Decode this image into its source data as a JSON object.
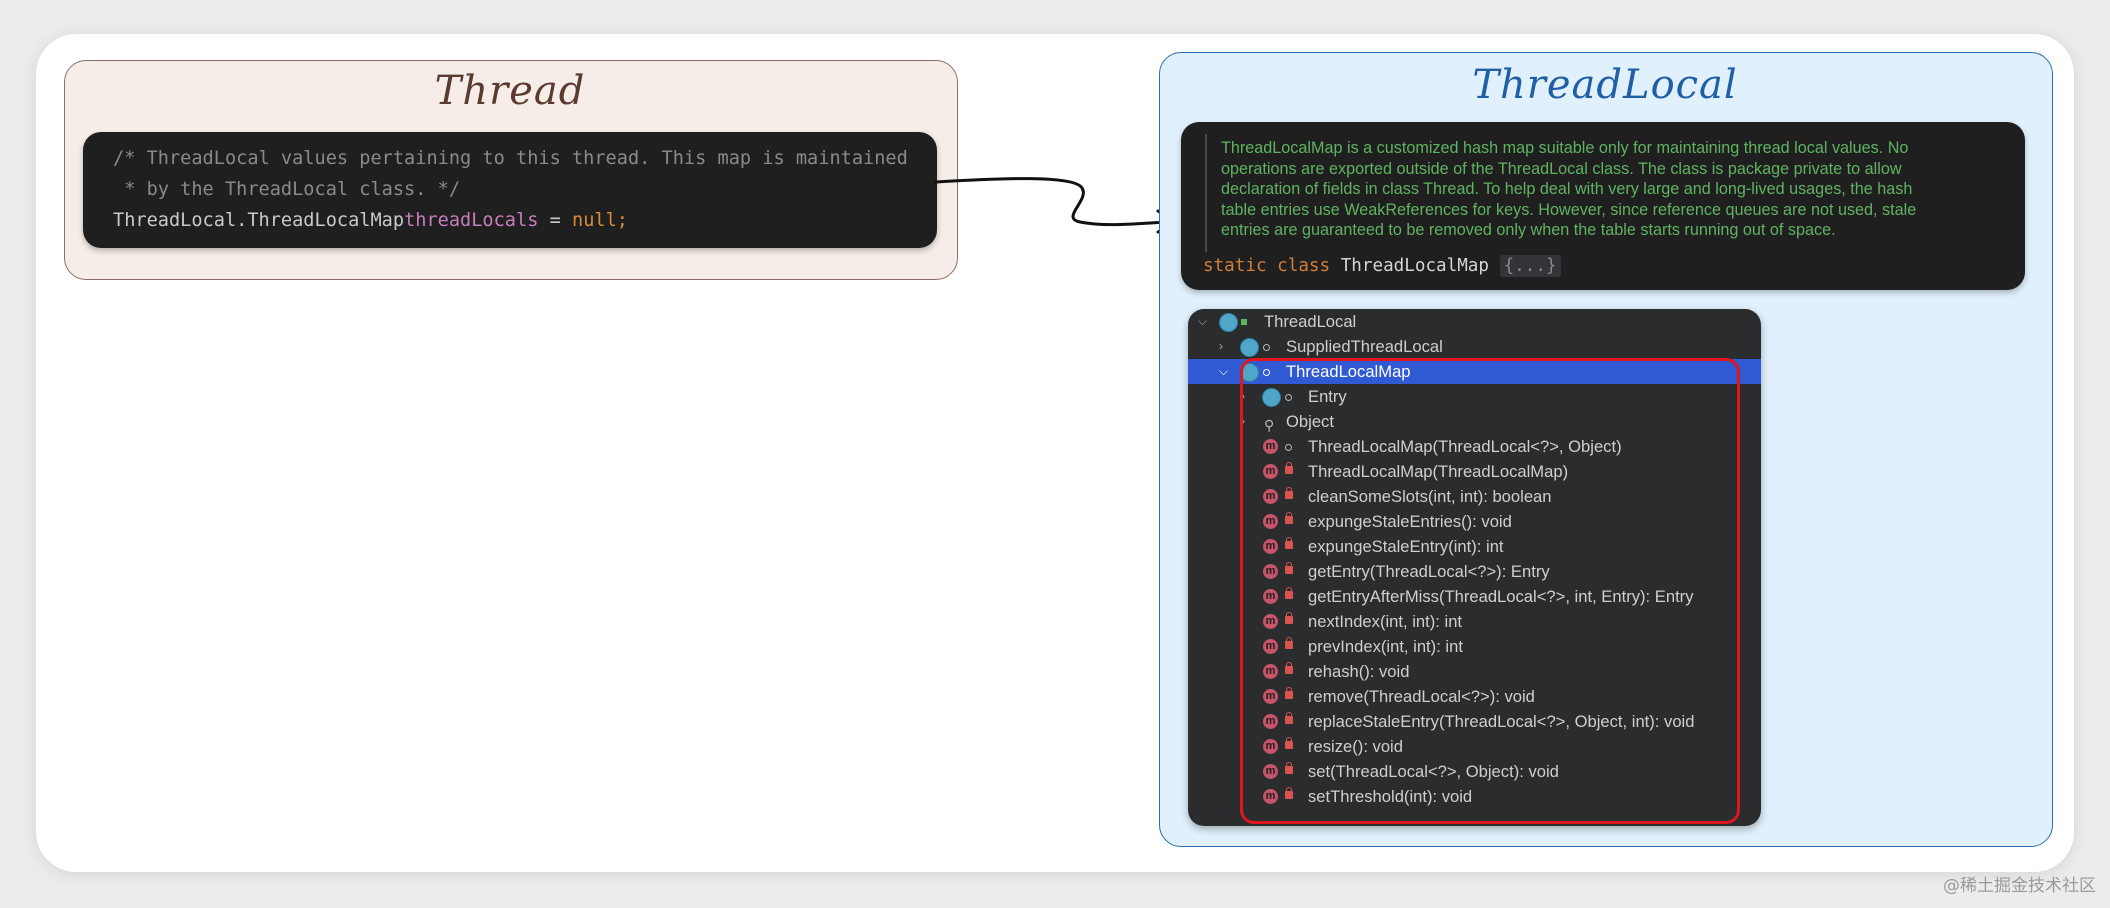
{
  "thread": {
    "title": "Thread",
    "code_comment_1": "/* ThreadLocal values pertaining to this thread. This map is maintained",
    "code_comment_2": " * by the ThreadLocal class. */",
    "code_type": "ThreadLocal.ThreadLocalMap",
    "code_field": "threadLocals",
    "code_eq": " = ",
    "code_null": "null",
    "code_semi": ";"
  },
  "threadlocal": {
    "title": "ThreadLocal",
    "doc_lines": [
      "ThreadLocalMap is a customized hash map suitable only for maintaining thread local values. No",
      "operations are exported outside of the ThreadLocal class. The class is package private to allow",
      "declaration of fields in class Thread. To help deal with very large and long-lived usages, the hash",
      "table entries use WeakReferences for keys. However, since reference queues are not used, stale",
      "entries are guaranteed to be removed only when the table starts running out of space."
    ],
    "code_kw": "static class",
    "code_name": " ThreadLocalMap ",
    "code_fold": "{...}"
  },
  "tree": {
    "root": "ThreadLocal",
    "nodes": [
      "SuppliedThreadLocal",
      "ThreadLocalMap",
      "Entry",
      "Object"
    ],
    "methods": [
      "ThreadLocalMap(ThreadLocal<?>, Object)",
      "ThreadLocalMap(ThreadLocalMap)",
      "cleanSomeSlots(int, int): boolean",
      "expungeStaleEntries(): void",
      "expungeStaleEntry(int): int",
      "getEntry(ThreadLocal<?>): Entry",
      "getEntryAfterMiss(ThreadLocal<?>, int, Entry): Entry",
      "nextIndex(int, int): int",
      "prevIndex(int, int): int",
      "rehash(): void",
      "remove(ThreadLocal<?>): void",
      "replaceStaleEntry(ThreadLocal<?>, Object, int): void",
      "resize(): void",
      "set(ThreadLocal<?>, Object): void",
      "setThreshold(int): void"
    ],
    "method_icon": "m"
  },
  "watermark": "@稀土掘金技术社区",
  "colors": {
    "highlight": "#e0161e",
    "selected_row": "#2f5ad3",
    "thread_panel": "#f6ede8",
    "threadlocal_panel": "#e0f0fc"
  },
  "icons": {
    "class": "class-icon",
    "method": "method-icon",
    "lock": "lock-icon",
    "object": "hierarchy-icon"
  }
}
